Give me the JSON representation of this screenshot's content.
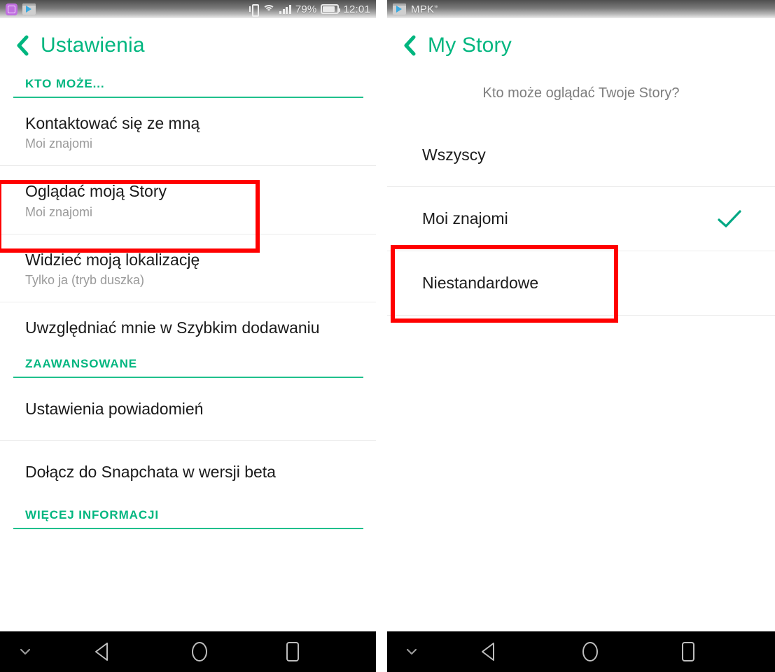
{
  "left_screen": {
    "statusbar": {
      "icons_left": [
        "gallery-icon",
        "google-play-icon"
      ],
      "icons_right": [
        "vibrate-icon",
        "wifi-icon",
        "signal-icon",
        "battery-icon"
      ],
      "battery_percent": "79%",
      "clock": "12:01"
    },
    "header": {
      "back_icon": "back-chevron-icon",
      "title": "Ustawienia"
    },
    "sections": [
      {
        "heading": "KTO MOŻE...",
        "rows": [
          {
            "title": "Kontaktować się ze mną",
            "subtitle": "Moi znajomi"
          },
          {
            "title": "Oglądać moją Story",
            "subtitle": "Moi znajomi",
            "highlighted": true
          },
          {
            "title": "Widzieć moją lokalizację",
            "subtitle": "Tylko ja (tryb duszka)"
          },
          {
            "title": "Uwzględniać mnie w Szybkim dodawaniu",
            "subtitle": ""
          }
        ]
      },
      {
        "heading": "ZAAWANSOWANE",
        "rows": [
          {
            "title": "Ustawienia powiadomień",
            "subtitle": ""
          },
          {
            "title": "Dołącz do Snapchata w wersji beta",
            "subtitle": ""
          }
        ]
      },
      {
        "heading": "WIĘCEJ INFORMACJI",
        "rows": []
      }
    ]
  },
  "right_screen": {
    "statusbar": {
      "icons_left": [
        "google-play-icon"
      ],
      "notification_text": "MPK”"
    },
    "header": {
      "back_icon": "back-chevron-icon",
      "title": "My Story"
    },
    "prompt": "Kto może oglądać Twoje Story?",
    "options": [
      {
        "label": "Wszyscy",
        "checked": false
      },
      {
        "label": "Moi znajomi",
        "checked": true
      },
      {
        "label": "Niestandardowe",
        "checked": false,
        "highlighted": true
      }
    ]
  },
  "navbar": {
    "buttons": [
      "chevron-down-icon",
      "back-triangle-icon",
      "home-circle-icon",
      "recents-square-icon"
    ]
  },
  "colors": {
    "accent_green": "#00b67f",
    "annotation_red": "#ff0000",
    "text_primary": "#1b1b1b",
    "text_secondary": "#9a9a9a",
    "navbar_bg": "#000000"
  }
}
